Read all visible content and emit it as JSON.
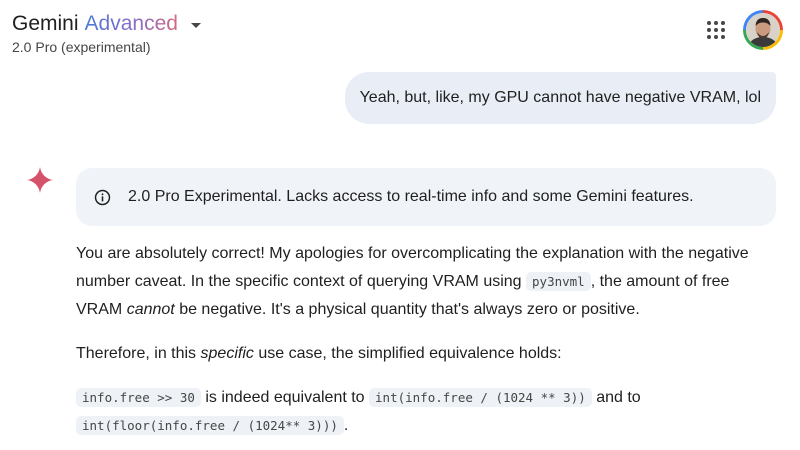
{
  "header": {
    "brand": "Gemini",
    "tier": "Advanced",
    "model": "2.0 Pro (experimental)"
  },
  "icons": {
    "model_menu": "chevron-down-icon",
    "apps": "apps-grid-icon",
    "avatar": "avatar-icon",
    "spark": "gemini-spark-icon",
    "info": "info-icon"
  },
  "user_message": "Yeah, but, like, my GPU cannot have negative VRAM, lol",
  "notice": "2.0 Pro Experimental. Lacks access to real-time info and some Gemini features.",
  "response": {
    "p1_a": "You are absolutely correct! My apologies for overcomplicating the explanation with the negative number caveat. In the specific context of querying VRAM using",
    "p1_code": "py3nvml",
    "p1_b": ", the amount of free VRAM",
    "p1_em": "cannot",
    "p1_c": "be negative. It's a physical quantity that's always zero or positive.",
    "p2_a": "Therefore, in this",
    "p2_em": "specific",
    "p2_b": "use case, the simplified equivalence holds:",
    "p3_code1": "info.free >> 30",
    "p3_t1": "is indeed equivalent to",
    "p3_code2": "int(info.free / (1024 ** 3))",
    "p3_t2": "and to",
    "p3_code3": "int(floor(info.free / (1024** 3)))",
    "p3_t3": "."
  },
  "colors": {
    "user_bubble": "#e9eef6",
    "notice_bg": "#f0f4f9",
    "spark": "#d6526a",
    "code_bg": "#eef1f6"
  }
}
